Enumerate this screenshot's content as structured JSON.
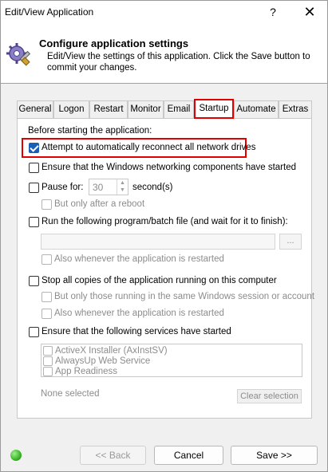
{
  "window": {
    "title": "Edit/View Application",
    "help": "?",
    "close": "✕"
  },
  "header": {
    "title": "Configure application settings",
    "description": "Edit/View the settings of this application. Click the Save button to commit your changes."
  },
  "tabs": [
    "General",
    "Logon",
    "Restart",
    "Monitor",
    "Email",
    "Startup",
    "Automate",
    "Extras"
  ],
  "active_tab": "Startup",
  "startup": {
    "section_label": "Before starting the application:",
    "reconnect_drives": "Attempt to automatically reconnect all network drives",
    "ensure_networking": "Ensure that the Windows networking components have started",
    "pause_for": "Pause for:",
    "pause_value": "30",
    "seconds": "second(s)",
    "only_after_reboot": "But only after a reboot",
    "run_program": "Run the following program/batch file (and wait for it to finish):",
    "browse": "...",
    "also_restarted_1": "Also whenever the application is restarted",
    "stop_copies": "Stop all copies of the application running on this computer",
    "same_session": "But only those running in the same Windows session or account",
    "also_restarted_2": "Also whenever the application is restarted",
    "ensure_services": "Ensure that the following services have started",
    "services": [
      "ActiveX Installer (AxInstSV)",
      "AlwaysUp Web Service",
      "App Readiness"
    ],
    "none_selected": "None selected",
    "clear_selection": "Clear selection"
  },
  "footer": {
    "back": "<< Back",
    "cancel": "Cancel",
    "save": "Save >>"
  },
  "colors": {
    "highlight": "#e00000",
    "checked": "#1a5fb4",
    "status": "#2ca81a"
  }
}
